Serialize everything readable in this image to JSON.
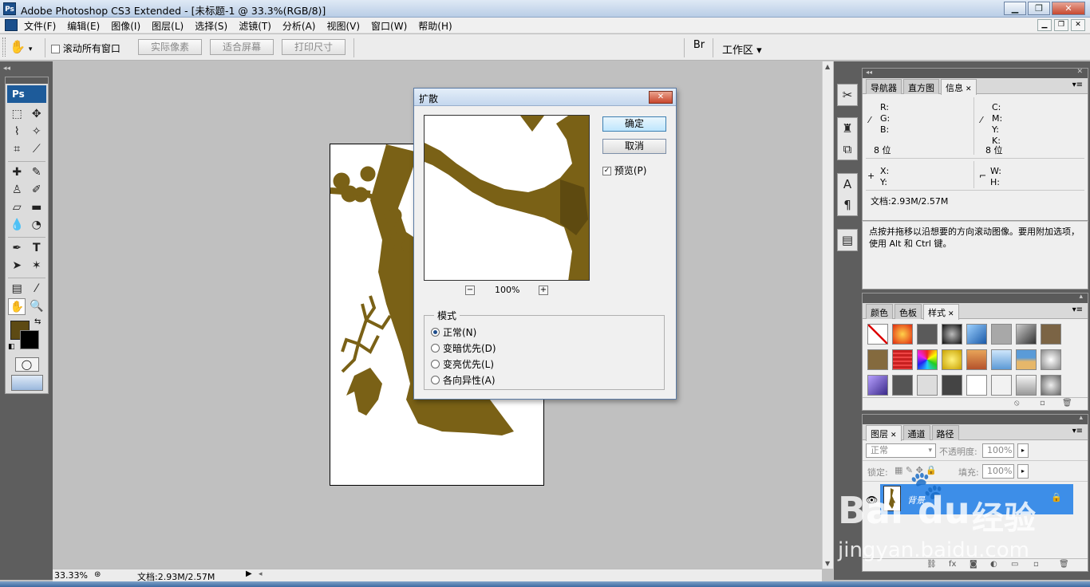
{
  "app": {
    "title": "Adobe Photoshop CS3 Extended - [未标题-1 @ 33.3%(RGB/8)]",
    "badge": "Ps"
  },
  "menus": [
    "文件(F)",
    "编辑(E)",
    "图像(I)",
    "图层(L)",
    "选择(S)",
    "滤镜(T)",
    "分析(A)",
    "视图(V)",
    "窗口(W)",
    "帮助(H)"
  ],
  "options": {
    "scroll_all": "滚动所有窗口",
    "actual_pixels": "实际像素",
    "fit_screen": "适合屏幕",
    "print_size": "打印尺寸",
    "workspace": "工作区 ▾"
  },
  "toolbox": {
    "logo": "Ps"
  },
  "dialog": {
    "title": "扩散",
    "ok": "确定",
    "cancel": "取消",
    "preview_label": "预览(P)",
    "preview_checked": true,
    "zoom": "100%",
    "mode_title": "模式",
    "modes": [
      "正常(N)",
      "变暗优先(D)",
      "变亮优先(L)",
      "各向异性(A)"
    ],
    "selected_mode": 0
  },
  "status": {
    "zoom": "33.33%",
    "doc": "文档:2.93M/2.57M"
  },
  "info_panel": {
    "tabs": [
      "导航器",
      "直方图",
      "信息"
    ],
    "active_tab": 2,
    "r": "R:",
    "g": "G:",
    "b": "B:",
    "c": "C:",
    "m": "M:",
    "y": "Y:",
    "k": "K:",
    "bits_left": "8 位",
    "bits_right": "8 位",
    "x": "X:",
    "yy": "Y:",
    "w": "W:",
    "h": "H:",
    "doc": "文档:2.93M/2.57M",
    "hint": "点按并拖移以沿想要的方向滚动图像。要用附加选项，使用 Alt 和 Ctrl 键。"
  },
  "styles_panel": {
    "tabs": [
      "颜色",
      "色板",
      "样式"
    ],
    "active_tab": 2
  },
  "layers_panel": {
    "tabs": [
      "图层",
      "通道",
      "路径"
    ],
    "active_tab": 0,
    "blend_mode": "正常",
    "opacity_label": "不透明度:",
    "opacity": "100%",
    "lock_label": "锁定:",
    "fill_label": "填充:",
    "fill": "100%",
    "layer_name": "背景"
  },
  "watermark": {
    "brand_a": "Bai",
    "brand_b": "du",
    "brand_c": "经验",
    "url": "jingyan.baidu.com"
  },
  "colors": {
    "foreground": "#5d4a13",
    "background": "#000000",
    "image_brown": "#7a6116",
    "layer_selected": "#3d8ee8"
  }
}
